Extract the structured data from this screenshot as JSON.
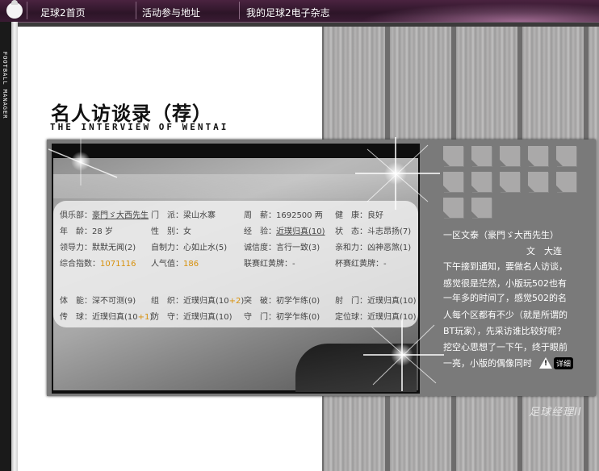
{
  "nav": {
    "home": "足球2首页",
    "activity": "活动参与地址",
    "magazine": "我的足球2电子杂志"
  },
  "sidebar": {
    "vertical_text": "FOOTBALL MANAGER"
  },
  "title": {
    "cn": "名人访谈录（荐）",
    "en": "THE INTERVIEW OF WENTAI"
  },
  "info": {
    "row1": [
      {
        "label": "俱乐部：",
        "value": "豪門ゞ大西先生"
      },
      {
        "label": "门　派：",
        "value": "梁山水寨"
      },
      {
        "label": "周　薪：",
        "value": "1692500 两"
      },
      {
        "label": "健　康：",
        "value": "良好"
      }
    ],
    "row2": [
      {
        "label": "年　龄：",
        "value": "28 岁"
      },
      {
        "label": "性　别：",
        "value": "女"
      },
      {
        "label": "经　验：",
        "value": "近璞归真(10)"
      },
      {
        "label": "状　态：",
        "value": "斗志昂扬(7)"
      }
    ],
    "row3": [
      {
        "label": "领导力：",
        "value": "默默无闻(2)"
      },
      {
        "label": "自制力：",
        "value": "心如止水(5)"
      },
      {
        "label": "诚信度：",
        "value": "言行一致(3)"
      },
      {
        "label": "亲和力：",
        "value": "凶神恶煞(1)"
      }
    ],
    "row4": [
      {
        "label": "综合指数：",
        "value": "1071116"
      },
      {
        "label": "人气值：",
        "value": "186"
      },
      {
        "label": "联赛红黄牌：",
        "value": "-"
      },
      {
        "label": "杯赛红黄牌：",
        "value": "-"
      }
    ],
    "row5": [
      {
        "label": "体　能：",
        "value": "深不可测(9)"
      },
      {
        "label": "组　织：",
        "value": "近璞归真(10",
        "bonus": "+2",
        "tail": ")"
      },
      {
        "label": "突　破：",
        "value": "初学乍练(0)"
      },
      {
        "label": "射　门：",
        "value": "近璞归真(10)"
      }
    ],
    "row6": [
      {
        "label": "传　球：",
        "value": "近璞归真(10",
        "bonus": "+1",
        "tail": ")"
      },
      {
        "label": "防　守：",
        "value": "近璞归真(10)"
      },
      {
        "label": "守　门：",
        "value": "初学乍练(0)"
      },
      {
        "label": "定位球：",
        "value": "近璞归真(10)"
      }
    ]
  },
  "article": {
    "head": "一区文泰（豪門ゞ大西先生）",
    "author": "文　大连",
    "lines": [
      "下午接到通知，要做名人访谈，",
      "感觉很是茫然，小版玩502也有",
      "一年多的时间了，感觉502的名",
      "人每个区都有不少（就是所谓的",
      "BT玩家），先采访谁比较好呢？",
      "挖空心思想了一下午，终于眼前",
      "一亮，小版的偶像同时"
    ],
    "detail_label": "详细",
    "warn_glyph": "!"
  },
  "footer": {
    "logo": "足球经理II"
  },
  "colors": {
    "highlight": "#d7900a",
    "panel": "#7a7a7a",
    "topbar": "#2d1528"
  }
}
